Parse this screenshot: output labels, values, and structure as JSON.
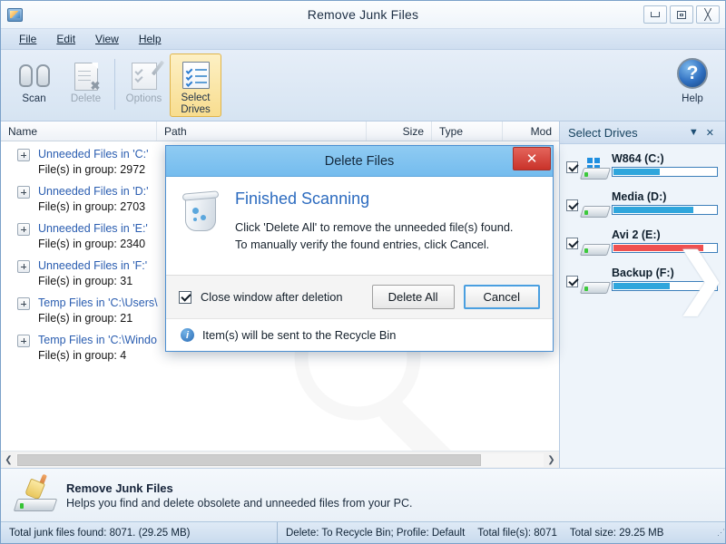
{
  "window": {
    "title": "Remove Junk Files",
    "app_icon": "app-monitor-icon",
    "minimize_label": "Minimize",
    "maximize_label": "Maximize",
    "close_label": "Close"
  },
  "menu": [
    {
      "label": "File"
    },
    {
      "label": "Edit"
    },
    {
      "label": "View"
    },
    {
      "label": "Help"
    }
  ],
  "toolbar": {
    "buttons": [
      {
        "label": "Scan",
        "icon": "binoculars-icon",
        "state": "enabled"
      },
      {
        "label": "Delete",
        "icon": "delete-document-icon",
        "state": "disabled"
      },
      {
        "label": "Options",
        "icon": "options-pencil-icon",
        "state": "disabled"
      },
      {
        "label": "Select\nDrives",
        "line1": "Select",
        "line2": "Drives",
        "icon": "checklist-icon",
        "state": "active"
      }
    ],
    "help": {
      "label": "Help",
      "icon": "question-mark-icon"
    }
  },
  "list": {
    "columns": [
      {
        "label": "Name"
      },
      {
        "label": "Path"
      },
      {
        "label": "Size"
      },
      {
        "label": "Type"
      },
      {
        "label": "Mod"
      }
    ],
    "rows": [
      {
        "title": "Unneeded Files in 'C:'",
        "subtitle": "File(s) in group: 2972"
      },
      {
        "title": "Unneeded Files in 'D:'",
        "subtitle": "File(s) in group: 2703"
      },
      {
        "title": "Unneeded Files in 'E:'",
        "subtitle": "File(s) in group: 2340"
      },
      {
        "title": "Unneeded Files in 'F:'",
        "subtitle": "File(s) in group: 31"
      },
      {
        "title": "Temp Files in 'C:\\Users\\",
        "subtitle": "File(s) in group: 21"
      },
      {
        "title": "Temp Files in 'C:\\Windo",
        "subtitle": "File(s) in group: 4"
      }
    ],
    "scroll_left_icon": "chevron-left-icon",
    "scroll_right_icon": "chevron-right-icon"
  },
  "drives_panel": {
    "title": "Select Drives",
    "dropdown_icon": "chevron-down-icon",
    "close_icon": "close-icon",
    "drives": [
      {
        "name": "W864 (C:)",
        "checked": true,
        "fill_percent": 45,
        "bar_color": "#2fa6dc",
        "has_windows_logo": true
      },
      {
        "name": "Media (D:)",
        "checked": true,
        "fill_percent": 78,
        "bar_color": "#2fa6dc",
        "has_windows_logo": false
      },
      {
        "name": "Avi 2 (E:)",
        "checked": true,
        "fill_percent": 88,
        "bar_color": "#ef5050",
        "has_windows_logo": false
      },
      {
        "name": "Backup (F:)",
        "checked": true,
        "fill_percent": 55,
        "bar_color": "#2fa6dc",
        "has_windows_logo": false
      }
    ],
    "decoration_icon": "double-chevron-right-icon"
  },
  "info_strip": {
    "icon": "broom-drive-icon",
    "title": "Remove Junk Files",
    "subtitle": "Helps you find and delete obsolete and unneeded files from your PC."
  },
  "status_bar": {
    "left": "Total junk files found: 8071. (29.25 MB)",
    "delete_mode": "Delete: To Recycle Bin; Profile: Default",
    "total_files": "Total file(s): 8071",
    "total_size": "Total size: 29.25 MB",
    "grip": "⋰"
  },
  "dialog": {
    "title": "Delete Files",
    "close_label": "x",
    "icon": "recycle-bin-icon",
    "heading": "Finished Scanning",
    "line1": "Click 'Delete All' to remove the unneeded file(s) found.",
    "line2": "To manually verify the found entries, click Cancel.",
    "checkbox_label": "Close window after deletion",
    "checkbox_checked": true,
    "delete_all_label": "Delete All",
    "cancel_label": "Cancel",
    "footer_icon": "info-icon",
    "footer_text": "Item(s) will be sent to the Recycle Bin"
  },
  "colors": {
    "accent": "#2a5db0",
    "title_blue": "#74bcee",
    "danger": "#c9332a",
    "active_tool": "#f8dd8f",
    "drive_bar_blue": "#2fa6dc",
    "drive_bar_red": "#ef5050"
  }
}
